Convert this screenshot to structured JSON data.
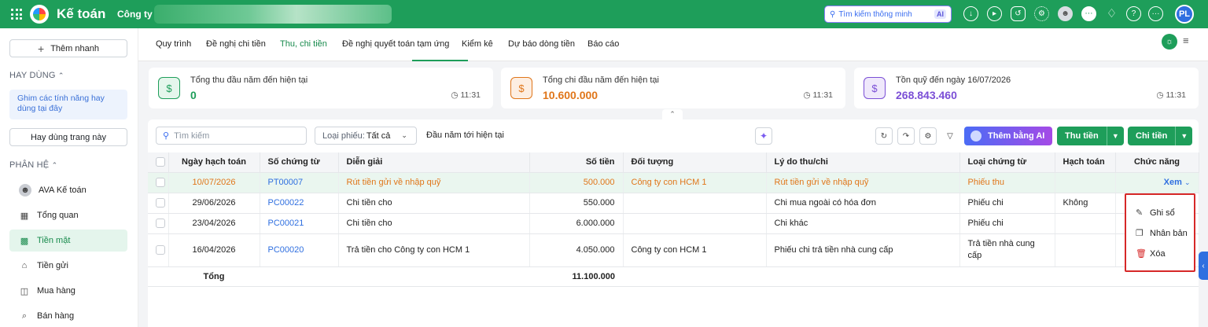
{
  "app": {
    "title": "Kế toán",
    "company_label": "Công ty"
  },
  "top": {
    "search_placeholder": "Tìm kiếm thông minh",
    "ai_badge": "AI",
    "avatar": "PL",
    "icons": [
      "download-icon",
      "play-icon",
      "share-icon",
      "settings-icon",
      "user-photo-icon",
      "chat-icon",
      "bell-icon",
      "help-icon",
      "more-icon"
    ]
  },
  "sidebar": {
    "quick_add": "Thêm nhanh",
    "favorites_title": "HAY DÙNG",
    "pin_hint": "Ghim các tính năng hay dùng tại đây",
    "favorite_page": "Hay dùng trang này",
    "modules_title": "PHÂN HỆ",
    "items": [
      {
        "label": "AVA Kế toán",
        "icon": "ava-avatar-icon"
      },
      {
        "label": "Tổng quan",
        "icon": "grid-icon"
      },
      {
        "label": "Tiền mặt",
        "icon": "cash-icon",
        "active": true
      },
      {
        "label": "Tiền gửi",
        "icon": "bank-icon"
      },
      {
        "label": "Mua hàng",
        "icon": "shopping-bag-icon"
      },
      {
        "label": "Bán hàng",
        "icon": "cart-icon"
      }
    ]
  },
  "tabs": [
    "Quy trình",
    "Đề nghị chi tiền",
    "Thu, chi tiền",
    "Đề nghị quyết toán tạm ứng",
    "Kiểm kê",
    "Dự báo dòng tiền",
    "Báo cáo"
  ],
  "active_tab": "Thu, chi tiền",
  "cards": [
    {
      "label": "Tổng thu đầu năm đến hiện tại",
      "value": "0",
      "time": "11:31",
      "color": "#1e9e5a"
    },
    {
      "label": "Tổng chi đầu năm đến hiện tại",
      "value": "10.600.000",
      "time": "11:31",
      "color": "#e0761a"
    },
    {
      "label": "Tồn quỹ đến ngày 16/07/2026",
      "value": "268.843.460",
      "time": "11:31",
      "color": "#7b4fd6"
    }
  ],
  "toolbar": {
    "search_placeholder": "Tìm kiếm",
    "filter_label": "Loại phiếu:",
    "filter_value": "Tất cả",
    "period": "Đầu năm tới hiện tại",
    "ai_button": "Thêm bằng AI",
    "receipt_button": "Thu tiền",
    "payment_button": "Chi tiền"
  },
  "table": {
    "columns": [
      "Ngày hạch toán",
      "Số chứng từ",
      "Diễn giải",
      "Số tiền",
      "Đối tượng",
      "Lý do thu/chi",
      "Loại chứng từ",
      "Hạch toán",
      "Chức năng"
    ],
    "rows": [
      {
        "date": "10/07/2026",
        "doc": "PT00007",
        "desc": "Rút tiền gửi về nhập quỹ",
        "amount": "500.000",
        "party": "Công ty con HCM 1",
        "reason": "Rút tiền gửi về nhập quỹ",
        "type": "Phiếu thu",
        "posted": "",
        "action": "Xem"
      },
      {
        "date": "29/06/2026",
        "doc": "PC00022",
        "desc": "Chi tiền cho",
        "amount": "550.000",
        "party": "",
        "reason": "Chi mua ngoài có hóa đơn",
        "type": "Phiếu chi",
        "posted": "Không",
        "action": ""
      },
      {
        "date": "23/04/2026",
        "doc": "PC00021",
        "desc": "Chi tiền cho",
        "amount": "6.000.000",
        "party": "",
        "reason": "Chi khác",
        "type": "Phiếu chi",
        "posted": "",
        "action": ""
      },
      {
        "date": "16/04/2026",
        "doc": "PC00020",
        "desc": "Trả tiền cho Công ty con HCM 1",
        "amount": "4.050.000",
        "party": "Công ty con HCM 1",
        "reason": "Phiếu chi trả tiền nhà cung cấp",
        "type": "Trả tiền nhà cung cấp",
        "posted": "",
        "action": ""
      }
    ],
    "total_label": "Tổng",
    "total_amount": "11.100.000"
  },
  "context_menu": [
    "Ghi sổ",
    "Nhân bản",
    "Xóa"
  ]
}
